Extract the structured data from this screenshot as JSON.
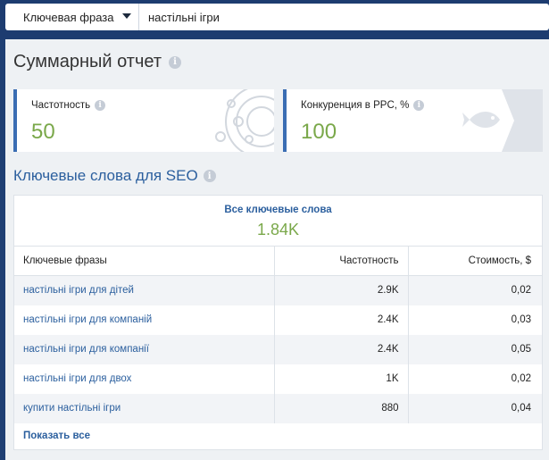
{
  "search": {
    "database_label": "Ключевая фраза",
    "query": "настільні ігри"
  },
  "summary": {
    "title": "Суммарный отчет"
  },
  "cards": [
    {
      "label": "Частотность",
      "value": "50"
    },
    {
      "label": "Конкуренция в PPC, %",
      "value": "100"
    }
  ],
  "seo": {
    "title": "Ключевые слова для SEO",
    "all_keywords_label": "Все ключевые слова",
    "all_keywords_value": "1.84K",
    "columns": [
      "Ключевые фразы",
      "Частотность",
      "Стоимость, $"
    ],
    "rows": [
      {
        "phrase": "настільні ігри для дітей",
        "frequency": "2.9K",
        "cost": "0,02"
      },
      {
        "phrase": "настільні ігри для компаній",
        "frequency": "2.4K",
        "cost": "0,03"
      },
      {
        "phrase": "настільні ігри для компанії",
        "frequency": "2.4K",
        "cost": "0,05"
      },
      {
        "phrase": "настільні ігри для двох",
        "frequency": "1K",
        "cost": "0,02"
      },
      {
        "phrase": "купити настільні ігри",
        "frequency": "880",
        "cost": "0,04"
      }
    ],
    "show_all_label": "Показать все"
  },
  "colors": {
    "accent": "#2b5f9e",
    "value_green": "#7aa84a",
    "header_bg": "#1d3c70"
  }
}
